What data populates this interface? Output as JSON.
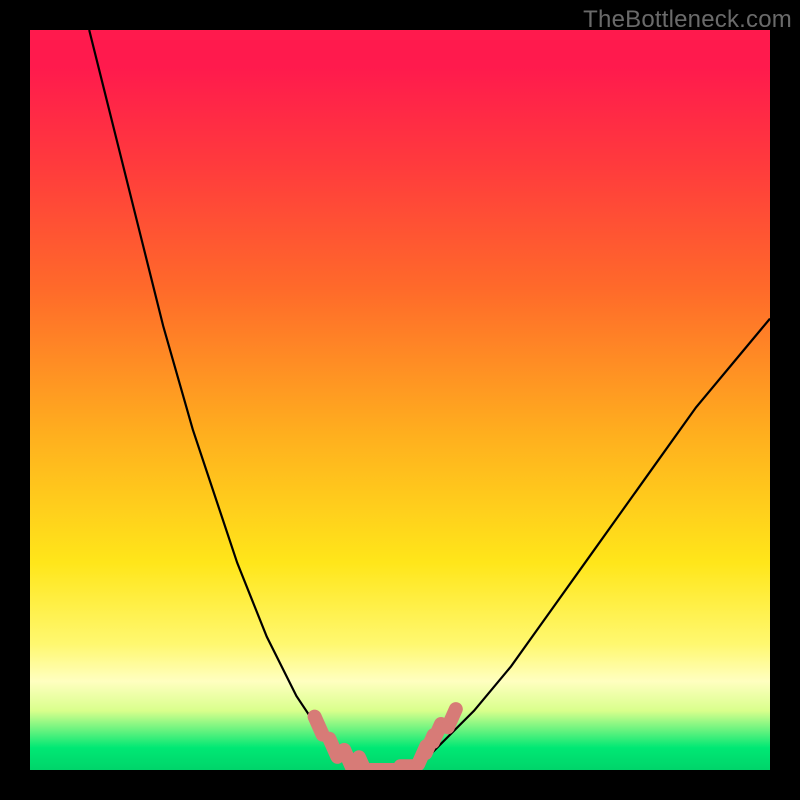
{
  "watermark": "TheBottleneck.com",
  "chart_data": {
    "type": "line",
    "title": "",
    "xlabel": "",
    "ylabel": "",
    "xlim": [
      0,
      100
    ],
    "ylim": [
      0,
      100
    ],
    "series": [
      {
        "name": "bottleneck-curve",
        "x": [
          8,
          10,
          12,
          14,
          16,
          18,
          20,
          22,
          24,
          26,
          28,
          30,
          32,
          34,
          36,
          38,
          40,
          42,
          44,
          46,
          48,
          50,
          52,
          54,
          56,
          60,
          65,
          70,
          75,
          80,
          85,
          90,
          95,
          100
        ],
        "y": [
          100,
          92,
          84,
          76,
          68,
          60,
          53,
          46,
          40,
          34,
          28,
          23,
          18,
          14,
          10,
          7,
          4,
          2,
          1,
          0,
          0,
          0,
          1,
          2,
          4,
          8,
          14,
          21,
          28,
          35,
          42,
          49,
          55,
          61
        ]
      }
    ],
    "markers": {
      "name": "highlight-dots",
      "color": "#d77b77",
      "points": [
        {
          "x": 39,
          "y": 6
        },
        {
          "x": 41,
          "y": 3
        },
        {
          "x": 43,
          "y": 1.5
        },
        {
          "x": 45,
          "y": 0.5
        },
        {
          "x": 47,
          "y": 0
        },
        {
          "x": 49,
          "y": 0
        },
        {
          "x": 51,
          "y": 0.5
        },
        {
          "x": 53,
          "y": 2
        },
        {
          "x": 54,
          "y": 3.5
        },
        {
          "x": 55,
          "y": 5
        },
        {
          "x": 57,
          "y": 7
        }
      ]
    },
    "green_band_y": 3
  }
}
